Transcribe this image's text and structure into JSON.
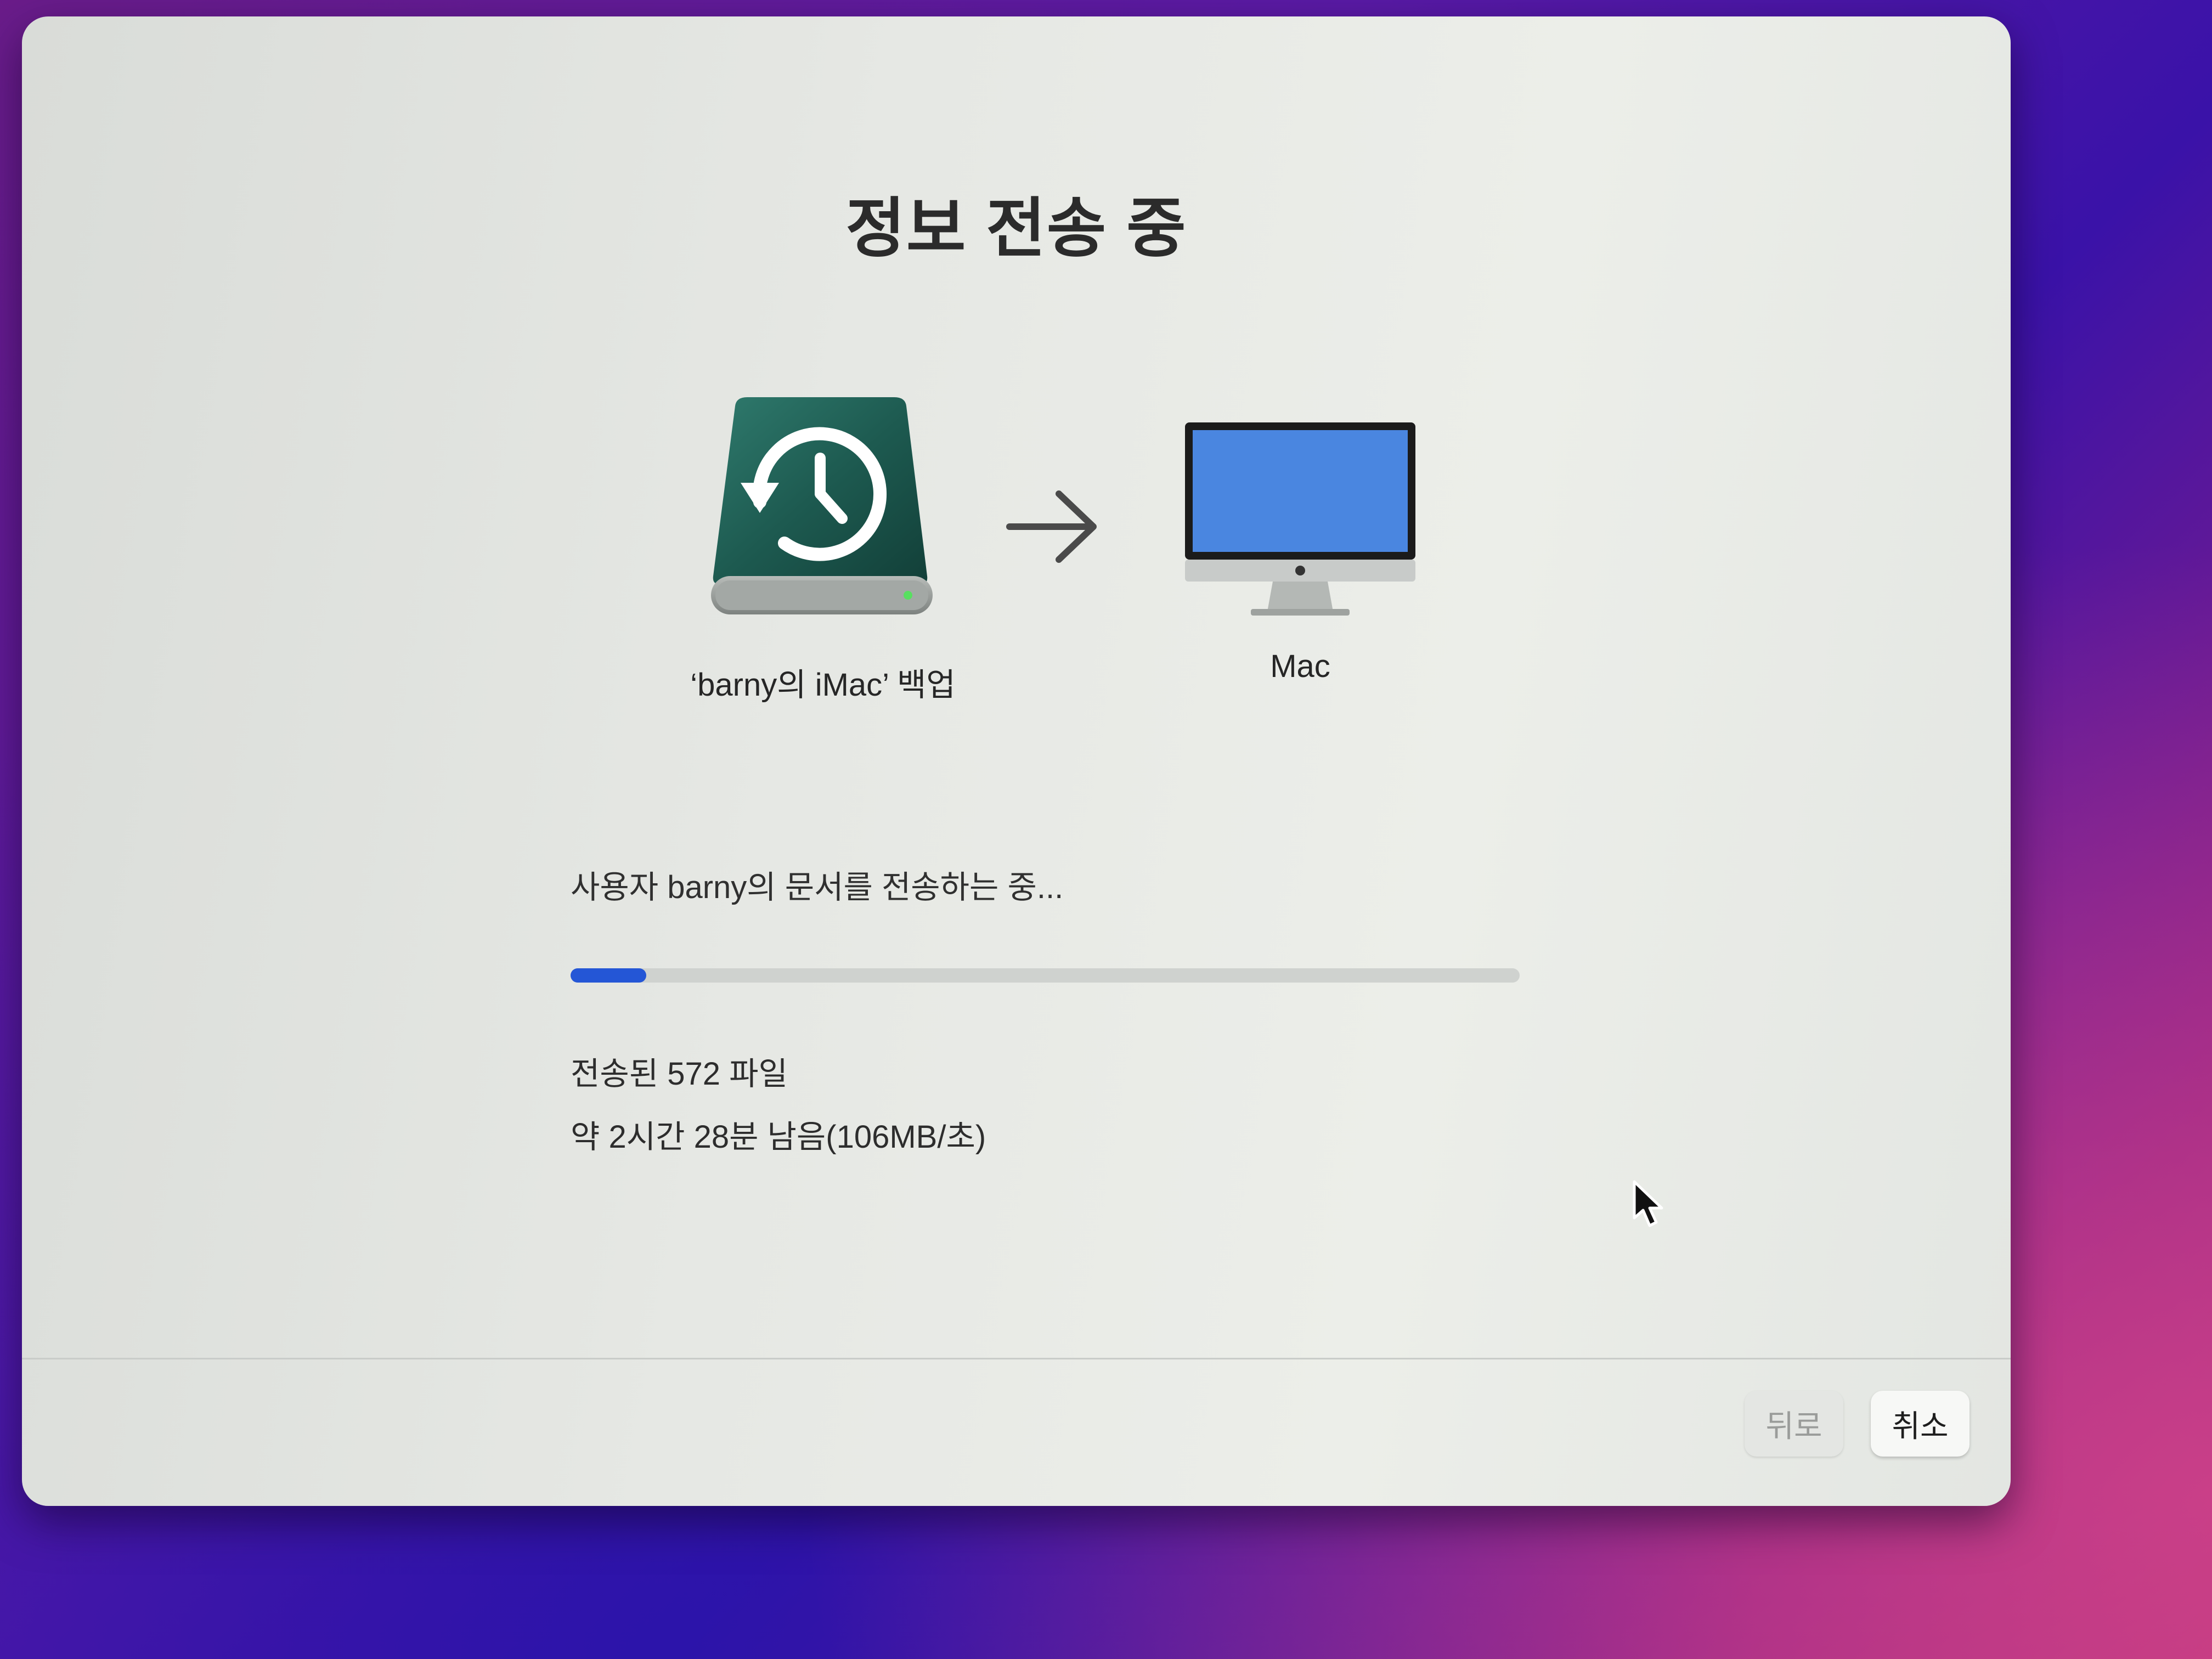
{
  "window": {
    "title": "정보 전송 중"
  },
  "source": {
    "label": "‘barny의 iMac’ 백업",
    "icon": "time-machine-drive-icon"
  },
  "target": {
    "label": "Mac",
    "icon": "imac-icon"
  },
  "transfer": {
    "status": "사용자 barny의 문서를 전송하는 중...",
    "progress": 0.08,
    "files_transferred": "전송된 572 파일",
    "time_remaining": "약 2시간 28분 남음(106MB/초)"
  },
  "buttons": {
    "back": "뒤로",
    "cancel": "취소"
  },
  "colors": {
    "accent": "#2456d6",
    "drive": "#1f5f55"
  }
}
